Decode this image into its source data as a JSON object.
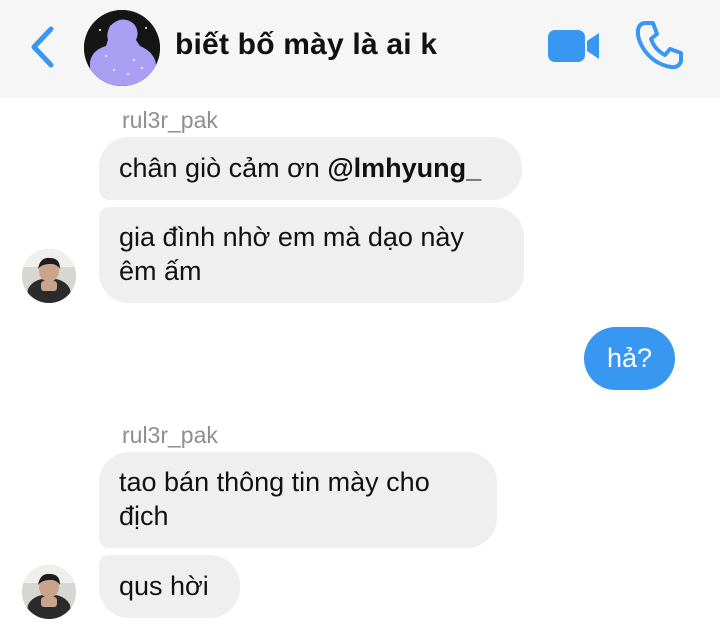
{
  "header": {
    "title": "biết bố mày là ai k",
    "back_icon": "chevron-left-icon",
    "video_icon": "video-camera-icon",
    "call_icon": "phone-icon",
    "accent_color": "#3897f0"
  },
  "messages": [
    {
      "sender": "rul3r_pak",
      "bubbles": [
        {
          "text": "chân giò cảm ơn ",
          "mention": "@lmhyung_"
        },
        {
          "line1": "gia đình nhờ em mà dạo này",
          "line2": "êm ấm"
        }
      ]
    },
    {
      "outgoing": true,
      "bubbles": [
        {
          "text": "hả?"
        }
      ]
    },
    {
      "sender": "rul3r_pak",
      "bubbles": [
        {
          "line1": "tao bán thông tin mày cho",
          "line2": "địch"
        },
        {
          "text": "qus hời"
        }
      ]
    }
  ],
  "colors": {
    "incoming_bubble": "#efeff0",
    "outgoing_bubble": "#3897f0",
    "header_background": "#f6f6f7"
  }
}
